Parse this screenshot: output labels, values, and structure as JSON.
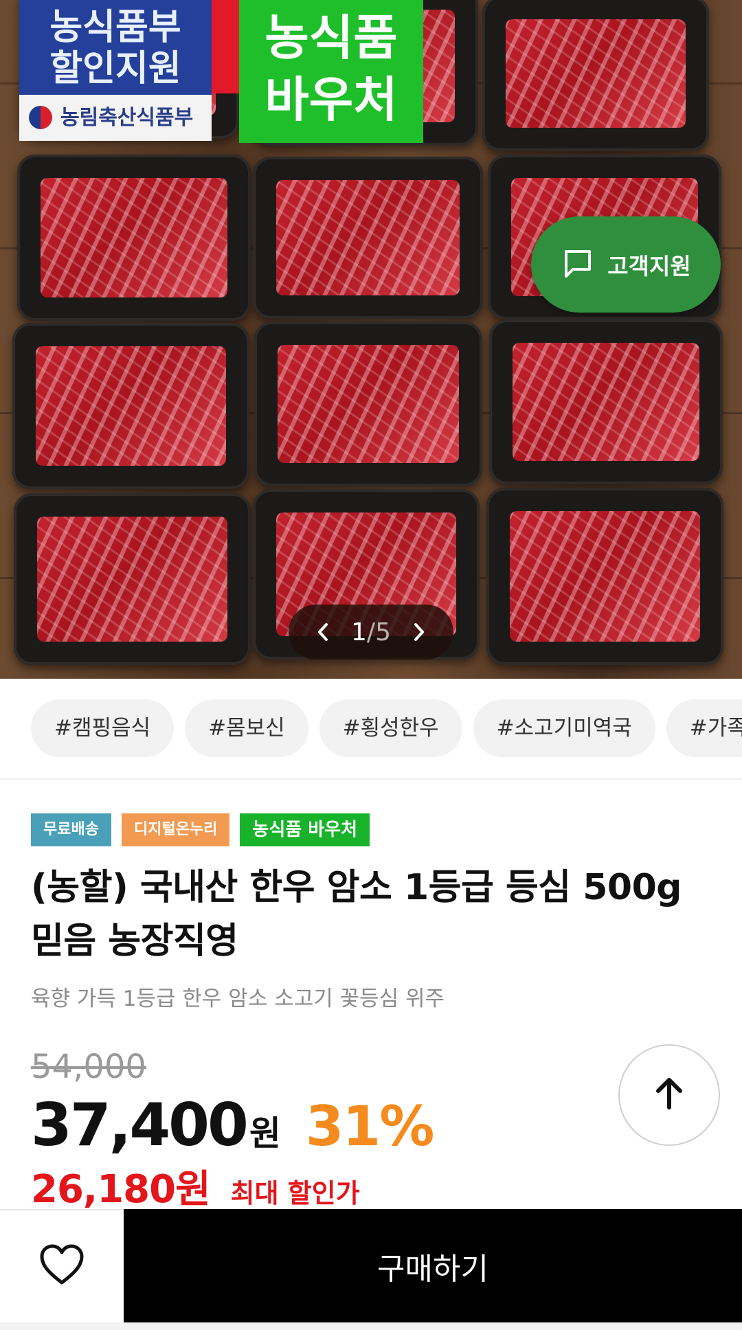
{
  "hero": {
    "gov_badge_line1": "농식품부",
    "gov_badge_line2": "할인지원",
    "gov_ministry": "농림축산식품부",
    "voucher_badge_line1": "농식품",
    "voucher_badge_line2": "바우처",
    "pager_current": "1",
    "pager_separator": "/",
    "pager_total": "5",
    "support_label": "고객지원"
  },
  "tags": [
    "#캠핑음식",
    "#몸보신",
    "#횡성한우",
    "#소고기미역국",
    "#가족"
  ],
  "labels": {
    "free_shipping": "무료배송",
    "digital_onnuri": "디지털온누리",
    "voucher": "농식품 바우처"
  },
  "product": {
    "title": "(농할) 국내산 한우 암소 1등급 등심 500g 믿음 농장직영",
    "subtitle": "육향 가득 1등급 한우 암소 소고기 꽃등심 위주",
    "original_price": "54,000",
    "price": "37,400",
    "currency": "원",
    "discount": "31%",
    "best_price": "26,180원",
    "best_price_label": "최대 할인가"
  },
  "actions": {
    "buy_label": "구매하기"
  },
  "colors": {
    "accent_orange": "#f58a1f",
    "accent_red": "#e3161b",
    "support_green": "#2f8f3c",
    "buy_black": "#000000"
  },
  "icons": {
    "wish": "heart-icon",
    "scroll_top": "arrow-up-icon",
    "support": "chat-bubble-icon",
    "pager_prev": "chevron-left-icon",
    "pager_next": "chevron-right-icon"
  }
}
